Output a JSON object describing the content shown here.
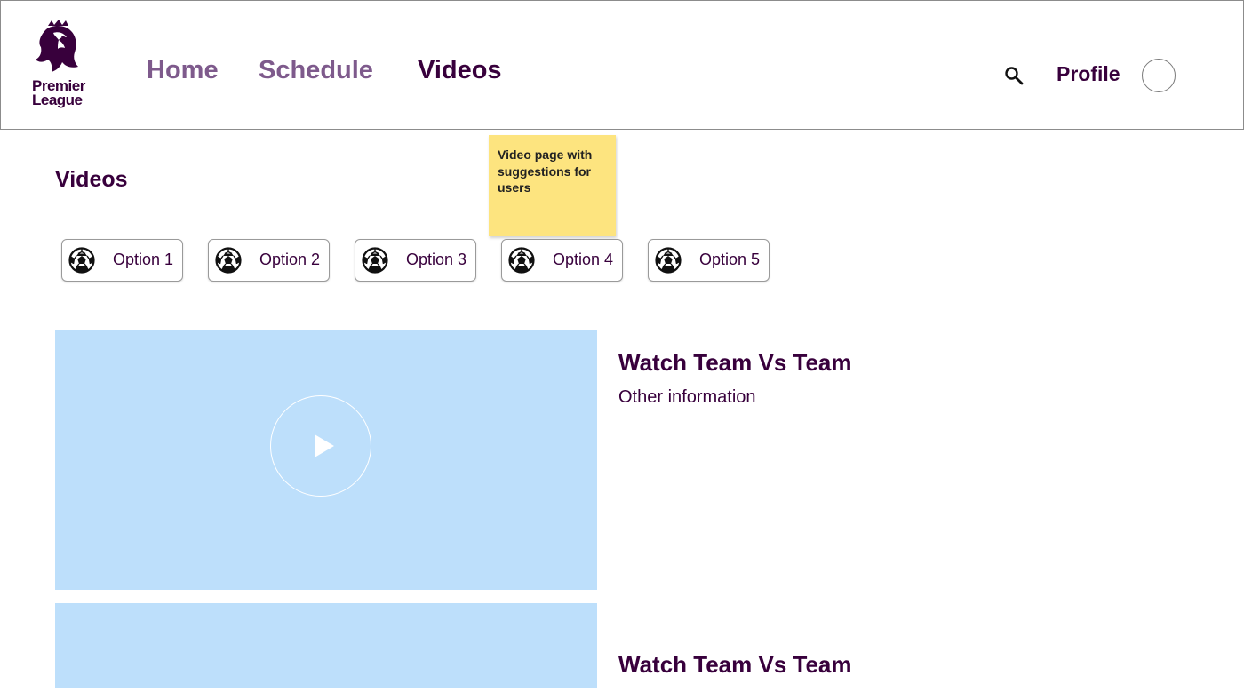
{
  "header": {
    "logo_text_line1": "Premier",
    "logo_text_line2": "League",
    "nav": {
      "home": "Home",
      "schedule": "Schedule",
      "videos": "Videos"
    },
    "active_nav": "Videos",
    "profile_label": "Profile"
  },
  "page": {
    "title": "Videos"
  },
  "annotation": {
    "text": "Video page with suggestions for users"
  },
  "filters": [
    {
      "label": "Option 1",
      "icon": "soccer-ball-icon"
    },
    {
      "label": "Option 2",
      "icon": "soccer-ball-icon"
    },
    {
      "label": "Option 3",
      "icon": "soccer-ball-icon"
    },
    {
      "label": "Option 4",
      "icon": "soccer-ball-icon"
    },
    {
      "label": "Option 5",
      "icon": "soccer-ball-icon"
    }
  ],
  "videos": [
    {
      "title": "Watch Team Vs Team",
      "info": "Other information"
    },
    {
      "title": "Watch Team Vs Team"
    }
  ],
  "colors": {
    "brand": "#38003c",
    "nav_inactive": "#7e5a8c",
    "thumbnail": "#bddffb",
    "sticky_note": "#fde47f"
  }
}
